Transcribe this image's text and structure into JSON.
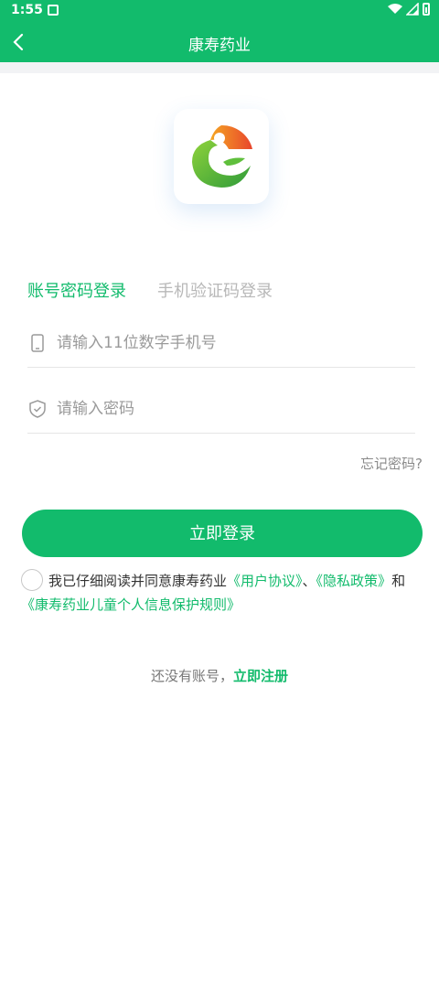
{
  "status": {
    "time": "1:55"
  },
  "nav": {
    "title": "康寿药业"
  },
  "tabs": {
    "active": "账号密码登录",
    "inactive": "手机验证码登录"
  },
  "phone": {
    "placeholder": "请输入11位数字手机号",
    "value": ""
  },
  "password": {
    "placeholder": "请输入密码",
    "value": ""
  },
  "forgot": "忘记密码?",
  "login_button": "立即登录",
  "agreement": {
    "text1": "我已仔细阅读并同意康寿药业",
    "user_agreement": "《用户协议》",
    "sep": "、",
    "privacy": "《隐私政策》",
    "and": "和",
    "child_rules": "《康寿药业儿童个人信息保护规则》"
  },
  "register": {
    "text": "还没有账号，",
    "link": "立即注册"
  },
  "colors": {
    "primary": "#12bb6c",
    "placeholder": "#9a9a9a",
    "inactive_tab": "#b8b8b8"
  }
}
